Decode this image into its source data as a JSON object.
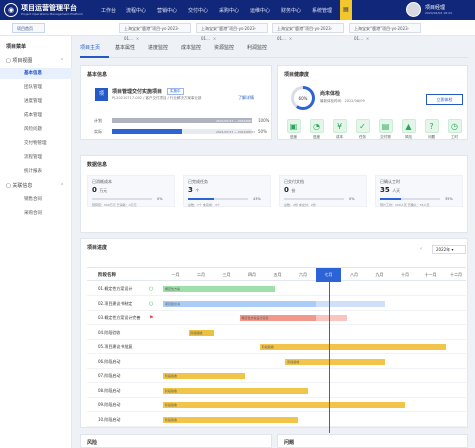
{
  "topbar": {
    "brand": "项目运营管理平台",
    "brand_sub": "Project Operations Management Platform",
    "logo": "logo",
    "nav": [
      "工作台",
      "流程中心",
      "营销中心",
      "交付中心",
      "采购中心",
      "运维中心",
      "财务中心",
      "系统管理"
    ],
    "active_nav_icon": "menu-icon",
    "user_name": "项目经理",
    "user_time": "2024/04/02 18:24"
  },
  "tabs": [
    {
      "label": "项目首页",
      "closable": false
    },
    {
      "label": "上海宝安“鹿港”项目-ys-2023-01...",
      "closable": true
    },
    {
      "label": "上海宝安“鹿港”项目-ys-2023-01...",
      "closable": true
    },
    {
      "label": "上海宝安“鹿港”项目-ys-2023-01...",
      "closable": true
    },
    {
      "label": "上海宝安“鹿港”项目-ys-2023-01...",
      "closable": true
    }
  ],
  "sidebar": {
    "title": "项目菜单",
    "group1": "项目视图",
    "items1": [
      "基本信息",
      "团队管理",
      "进度管理",
      "成本管理",
      "风险问题",
      "交付物管理",
      "流程管理",
      "统计报表"
    ],
    "group2": "关联信息",
    "items2": [
      "销售合同",
      "采购合同"
    ]
  },
  "subtabs": [
    "项目主页",
    "基本属性",
    "进度监控",
    "成本监控",
    "资源监控",
    "利润监控"
  ],
  "basic_info": {
    "title": "基本信息",
    "badge": "项",
    "project_name": "项目管理交付实施项目",
    "status_chip": "实施中",
    "subtitle": "PJ-20210717-002 / 客户交付项目 / 行业解决方案事业部",
    "detail_link": "了解详情",
    "plan_label": "计划",
    "plan_text": "2021/07/17 ~ 2022/08/31",
    "plan_value": "100%",
    "actual_label": "实际",
    "actual_text": "2021/07/17 ~ 2022/08/31",
    "actual_value": "50%",
    "plan_progress": 1.0,
    "actual_progress": 0.5
  },
  "health": {
    "title": "项目健康度",
    "percent_text": "60%",
    "percent": 60,
    "status": "尚未体检",
    "last_check": "最新体检时间：2022/08/09",
    "button": "立即体检",
    "quick_actions": [
      {
        "label": "进度",
        "icon": "folder-icon",
        "glyph": "▣"
      },
      {
        "label": "进度",
        "icon": "progress-icon",
        "glyph": "◔"
      },
      {
        "label": "成本",
        "icon": "cost-icon",
        "glyph": "¥"
      },
      {
        "label": "任务",
        "icon": "task-icon",
        "glyph": "✓"
      },
      {
        "label": "交付物",
        "icon": "deliverable-icon",
        "glyph": "▤"
      },
      {
        "label": "风险",
        "icon": "warning-icon",
        "glyph": "▲"
      },
      {
        "label": "问题",
        "icon": "issue-icon",
        "glyph": "?"
      },
      {
        "label": "工时",
        "icon": "timesheet-icon",
        "glyph": "◷"
      }
    ]
  },
  "data_info": {
    "title": "数据信息",
    "stats": [
      {
        "label": "已消耗成本",
        "value": "0",
        "unit": "万元",
        "percent_text": "0%",
        "percent": 0,
        "note": "预算值：500万元  已消耗：0万元"
      },
      {
        "label": "已完成任务",
        "value": "3",
        "unit": "个",
        "percent_text": "43%",
        "percent": 43,
        "note": "总数：7个  未完成：4个"
      },
      {
        "label": "已交付文档",
        "value": "0",
        "unit": "份",
        "percent_text": "0%",
        "percent": 0,
        "note": "总数：2份  未交付：2份"
      },
      {
        "label": "已确认工时",
        "value": "35",
        "unit": "人天",
        "percent_text": "35%",
        "percent": 35,
        "note": "预计工时：100人天  已确认：35人天"
      }
    ]
  },
  "gantt": {
    "title": "项目进度",
    "year": "2022年",
    "stage_header": "阶段名称",
    "months": [
      "一月",
      "二月",
      "三月",
      "四月",
      "五月",
      "六月",
      "七月",
      "八月",
      "九月",
      "十月",
      "十一月",
      "十二月"
    ],
    "current_month": 6,
    "tasks": [
      {
        "name": "01.概定性方案设计",
        "marker": "○",
        "marker_color": "#27a85a",
        "segments": [
          {
            "start": 0.0,
            "end": 4.4,
            "color": "#9fe0a8",
            "label": "概定性方案"
          }
        ]
      },
      {
        "name": "02.项目建议书制定",
        "marker": "○",
        "marker_color": "#27a85a",
        "segments": [
          {
            "start": 0.0,
            "end": 6.0,
            "color": "#a9cdf7",
            "label": "项目建议书"
          },
          {
            "start": 6.0,
            "end": 8.7,
            "color": "#cfe0f8",
            "label": ""
          }
        ]
      },
      {
        "name": "03.概定性方案设计完善",
        "marker": "⚑",
        "marker_color": "#d84343",
        "segments": [
          {
            "start": 3.0,
            "end": 6.0,
            "color": "#f1978c",
            "label": "概定性方案设计完善"
          },
          {
            "start": 6.0,
            "end": 7.2,
            "color": "#f8c5bf",
            "label": ""
          }
        ]
      },
      {
        "name": "04.阶段验收",
        "marker": "",
        "marker_color": "#999999",
        "segments": [
          {
            "start": 1.0,
            "end": 2.0,
            "color": "#ecc13f",
            "label": "阶段验收"
          }
        ]
      },
      {
        "name": "05.项目建议书批复",
        "marker": "",
        "marker_color": "#999999",
        "segments": [
          {
            "start": 3.8,
            "end": 11.1,
            "color": "#f2c54a",
            "label": "阶段验收"
          }
        ]
      },
      {
        "name": "06.阶段启动",
        "marker": "",
        "marker_color": "#999999",
        "segments": [
          {
            "start": 4.8,
            "end": 8.7,
            "color": "#f2c54a",
            "label": "阶段验收"
          }
        ]
      },
      {
        "name": "07.阶段启动",
        "marker": "",
        "marker_color": "#999999",
        "segments": [
          {
            "start": 0.0,
            "end": 3.2,
            "color": "#f2c54a",
            "label": "阶段验收"
          }
        ]
      },
      {
        "name": "08.阶段启动",
        "marker": "",
        "marker_color": "#999999",
        "segments": [
          {
            "start": 0.0,
            "end": 5.7,
            "color": "#f2c54a",
            "label": "阶段验收"
          }
        ]
      },
      {
        "name": "09.阶段启动",
        "marker": "",
        "marker_color": "#999999",
        "segments": [
          {
            "start": 0.0,
            "end": 9.5,
            "color": "#f2c54a",
            "label": "阶段验收"
          }
        ]
      },
      {
        "name": "10.阶段启动",
        "marker": "",
        "marker_color": "#999999",
        "segments": [
          {
            "start": 0.0,
            "end": 5.3,
            "color": "#f2c54a",
            "label": "阶段验收"
          }
        ]
      }
    ]
  },
  "bottom": {
    "risk_title": "风险",
    "issue_title": "问题"
  }
}
